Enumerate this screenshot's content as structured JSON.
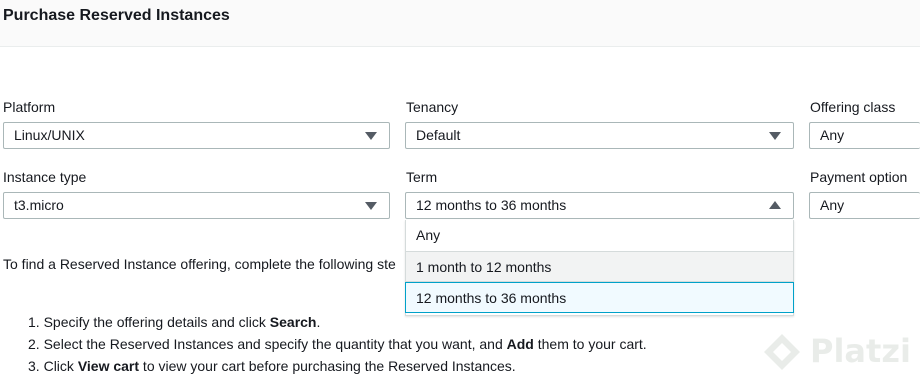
{
  "page": {
    "title": "Purchase Reserved Instances"
  },
  "filters": {
    "platform": {
      "label": "Platform",
      "value": "Linux/UNIX"
    },
    "tenancy": {
      "label": "Tenancy",
      "value": "Default"
    },
    "offering_class": {
      "label": "Offering class",
      "value": "Any"
    },
    "instance_type": {
      "label": "Instance type",
      "value": "t3.micro"
    },
    "term": {
      "label": "Term",
      "value": "12 months to 36 months",
      "options": [
        "Any",
        "1 month to 12 months",
        "12 months to 36 months"
      ]
    },
    "payment_option": {
      "label": "Payment option",
      "value": "Any"
    }
  },
  "instructions": {
    "intro": "To find a Reserved Instance offering, complete the following ste",
    "steps": [
      {
        "num": "1.",
        "before": "Specify the offering details and click ",
        "bold": "Search",
        "after": "."
      },
      {
        "num": "2.",
        "before": "Select the Reserved Instances and specify the quantity that you want, and ",
        "bold": "Add",
        "after": " them to your cart."
      },
      {
        "num": "3.",
        "before": "Click ",
        "bold": "View cart",
        "after": " to view your cart before purchasing the Reserved Instances."
      }
    ]
  },
  "watermark": {
    "text": "Platzi"
  },
  "colors": {
    "accent": "#00a1c9",
    "border": "#aab7b8",
    "header_bg": "#fafafa",
    "selected_bg": "#f1faff"
  }
}
